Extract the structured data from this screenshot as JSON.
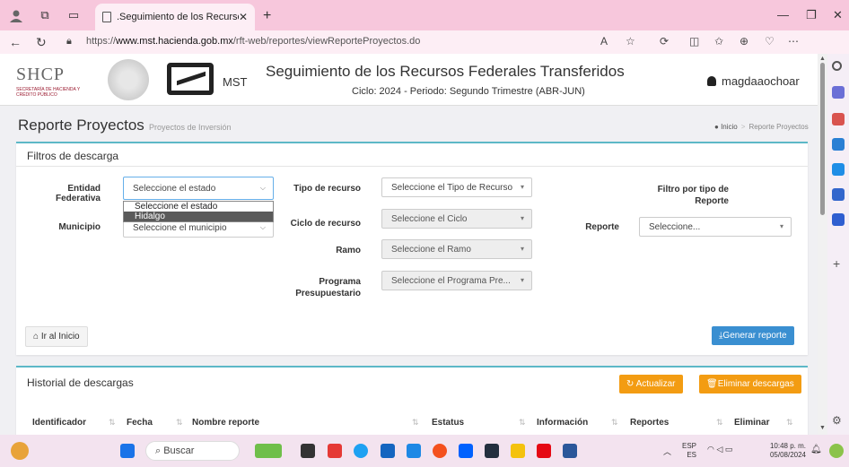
{
  "browser": {
    "tab_title": ".Seguimiento de los Recursos Fe",
    "url_prefix": "https://",
    "url_domain": "www.mst.hacienda.gob.mx",
    "url_path": "/rft-web/reportes/viewReporteProyectos.do"
  },
  "header": {
    "shcp": "SHCP",
    "shcp_sub": "SECRETARÍA DE HACIENDA Y CRÉDITO PÚBLICO",
    "mst": "MST",
    "title": "Seguimiento de los Recursos Federales Transferidos",
    "subtitle": "Ciclo: 2024 - Periodo: Segundo Trimestre (ABR-JUN)",
    "user": "magdaaochoar"
  },
  "page": {
    "title": "Reporte Proyectos",
    "subtitle": "Proyectos de Inversión",
    "breadcrumb_home": "Inicio",
    "breadcrumb_current": "Reporte Proyectos"
  },
  "filters": {
    "panel_title": "Filtros de descarga",
    "entidad_label_1": "Entidad",
    "entidad_label_2": "Federativa",
    "entidad_value": "Seleccione el estado",
    "entidad_options": [
      "Seleccione el estado",
      "Hidalgo"
    ],
    "municipio_label": "Municipio",
    "municipio_value": "Seleccione el municipio",
    "tipo_recurso_label": "Tipo de recurso",
    "tipo_recurso_value": "Seleccione el Tipo de Recurso",
    "ciclo_label": "Ciclo de recurso",
    "ciclo_value": "Seleccione el Ciclo",
    "ramo_label": "Ramo",
    "ramo_value": "Seleccione el Ramo",
    "programa_label_1": "Programa",
    "programa_label_2": "Presupuestario",
    "programa_value": "Seleccione el Programa Pre...",
    "filtro_tipo_label_1": "Filtro por tipo de",
    "filtro_tipo_label_2": "Reporte",
    "reporte_label": "Reporte",
    "reporte_value": "Seleccione...",
    "ir_inicio": "Ir al Inicio",
    "generar": "Generar reporte"
  },
  "history": {
    "panel_title": "Historial de descargas",
    "actualizar": "Actualizar",
    "eliminar_descargas": "Eliminar descargas",
    "columns": [
      "Identificador",
      "Fecha",
      "Nombre reporte",
      "Estatus",
      "Información",
      "Reportes",
      "Eliminar"
    ]
  },
  "taskbar": {
    "search": "Buscar",
    "lang_1": "ESP",
    "lang_2": "ES",
    "time": "10:48 p. m.",
    "date": "05/08/2024"
  }
}
